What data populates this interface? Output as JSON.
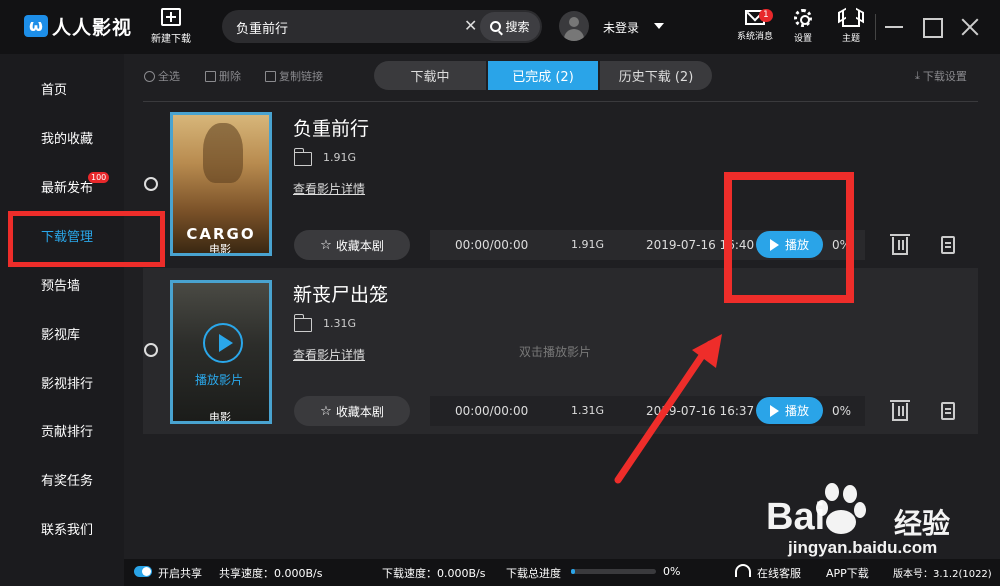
{
  "app": {
    "logo_text": "人人影视",
    "logo_mark": "ω"
  },
  "header": {
    "new_download": "新建下载",
    "search_value": "负重前行",
    "search_button": "搜索",
    "login": "未登录",
    "system_msg": "系统消息",
    "system_msg_badge": "1",
    "settings": "设置",
    "theme": "主题"
  },
  "sidebar": {
    "items": [
      {
        "label": "首页"
      },
      {
        "label": "我的收藏"
      },
      {
        "label": "最新发布",
        "badge": "100"
      },
      {
        "label": "下载管理",
        "active": true
      },
      {
        "label": "预告墙"
      },
      {
        "label": "影视库"
      },
      {
        "label": "影视排行"
      },
      {
        "label": "贡献排行"
      },
      {
        "label": "有奖任务"
      },
      {
        "label": "联系我们"
      }
    ]
  },
  "toolbar": {
    "select_all": "全选",
    "delete": "删除",
    "copy_link": "复制链接",
    "tabs": [
      "下载中",
      "已完成 (2)",
      "历史下载 (2)"
    ],
    "active_tab": "已完成 (2)",
    "download_settings": "下载设置"
  },
  "downloads": [
    {
      "title": "负重前行",
      "size": "1.91G",
      "detail_link": "查看影片详情",
      "fav_button": "收藏本剧",
      "poster_title": "CARGO",
      "poster_tag": "电影",
      "time": "00:00/00:00",
      "file_size": "1.91G",
      "date": "2019-07-16 16:40",
      "play_button": "播放",
      "progress": "0%"
    },
    {
      "title": "新丧尸出笼",
      "size": "1.31G",
      "detail_link": "查看影片详情",
      "fav_button": "收藏本剧",
      "poster_play": "播放影片",
      "poster_tag": "电影",
      "hint": "双击播放影片",
      "time": "00:00/00:00",
      "file_size": "1.31G",
      "date": "2019-07-16 16:37",
      "play_button": "播放",
      "progress": "0%"
    }
  ],
  "footer": {
    "share_toggle": "开启共享",
    "share_speed": "共享速度：0.000B/s",
    "download_speed": "下载速度：0.000B/s",
    "total_progress_label": "下载总进度",
    "total_progress": "0%",
    "total_progress_value": 0.05,
    "online_service": "在线客服",
    "app_download": "APP下载",
    "version": "版本号：3.1.2(1022)"
  },
  "watermark": {
    "brand": "Bai",
    "brand_cn": "经验",
    "url": "jingyan.baidu.com"
  },
  "colors": {
    "accent": "#2aa4e8",
    "annotation": "#ee2d2a",
    "background": "#1f1f22"
  }
}
